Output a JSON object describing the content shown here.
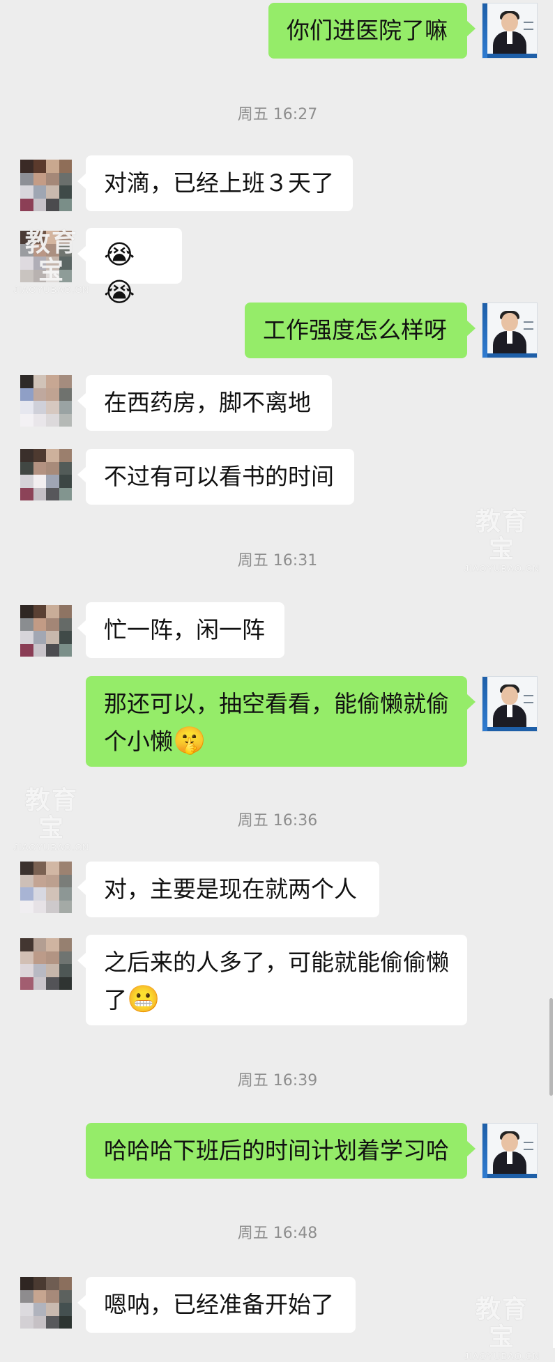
{
  "messages": [
    {
      "side": "out",
      "text": "你们进医院了嘛"
    },
    {
      "timestamp": "周五 16:27"
    },
    {
      "side": "in",
      "text": "对滴，已经上班３天了"
    },
    {
      "side": "in",
      "emoji": "😭😭"
    },
    {
      "side": "out",
      "text": "工作强度怎么样呀"
    },
    {
      "side": "in",
      "text": "在西药房，脚不离地"
    },
    {
      "side": "in",
      "text": "不过有可以看书的时间"
    },
    {
      "timestamp": "周五 16:31"
    },
    {
      "side": "in",
      "text": "忙一阵，闲一阵"
    },
    {
      "side": "out",
      "line1": "那还可以，抽空看看，能偷懒就偷",
      "line2": "个小懒",
      "emoji": "🤫"
    },
    {
      "timestamp": "周五 16:36"
    },
    {
      "side": "in",
      "text": "对，主要是现在就两个人"
    },
    {
      "side": "in",
      "line1": "之后来的人多了，可能就能偷偷懒",
      "line2": "了",
      "emoji": "😬"
    },
    {
      "timestamp": "周五 16:39"
    },
    {
      "side": "out",
      "text": "哈哈哈下班后的时间计划着学习哈"
    },
    {
      "timestamp": "周五 16:48"
    },
    {
      "side": "in",
      "text": "嗯呐，已经准备开始了"
    }
  ],
  "watermark": {
    "brand": "教育宝",
    "url": "JIAOYUBAO.CN"
  },
  "colors": {
    "background": "#ededed",
    "incoming_bubble": "#ffffff",
    "outgoing_bubble": "#95ec69",
    "timestamp": "#8e8e8e"
  }
}
